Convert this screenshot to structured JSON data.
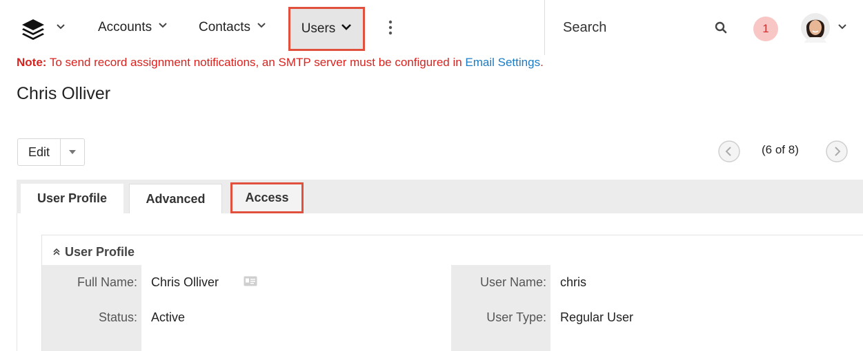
{
  "nav": {
    "accounts": "Accounts",
    "contacts": "Contacts",
    "users": "Users",
    "search_placeholder": "Search",
    "notification_count": "1"
  },
  "note": {
    "prefix": "Note:",
    "text": " To send record assignment notifications, an SMTP server must be configured in ",
    "link": "Email Settings",
    "suffix": "."
  },
  "record": {
    "title": "Chris Olliver",
    "edit_label": "Edit",
    "pager_text": "(6 of 8)"
  },
  "tabs": [
    "User Profile",
    "Advanced",
    "Access"
  ],
  "panel": {
    "header": "User Profile",
    "fields": {
      "full_name_label": "Full Name:",
      "full_name_value": "Chris Olliver",
      "user_name_label": "User Name:",
      "user_name_value": "chris",
      "status_label": "Status:",
      "status_value": "Active",
      "user_type_label": "User Type:",
      "user_type_value": "Regular User"
    }
  },
  "colors": {
    "highlight_border": "#e0503c",
    "note_red": "#d8231f",
    "link_blue": "#1a7bc4",
    "badge_bg": "#f9c6c6"
  },
  "icons": [
    "stack-logo-icon",
    "chevron-down-icon",
    "kebab-menu-icon",
    "search-icon",
    "avatar",
    "vcard-icon",
    "chevron-left-icon",
    "chevron-right-icon",
    "double-chevron-up-icon",
    "caret-down-icon"
  ]
}
